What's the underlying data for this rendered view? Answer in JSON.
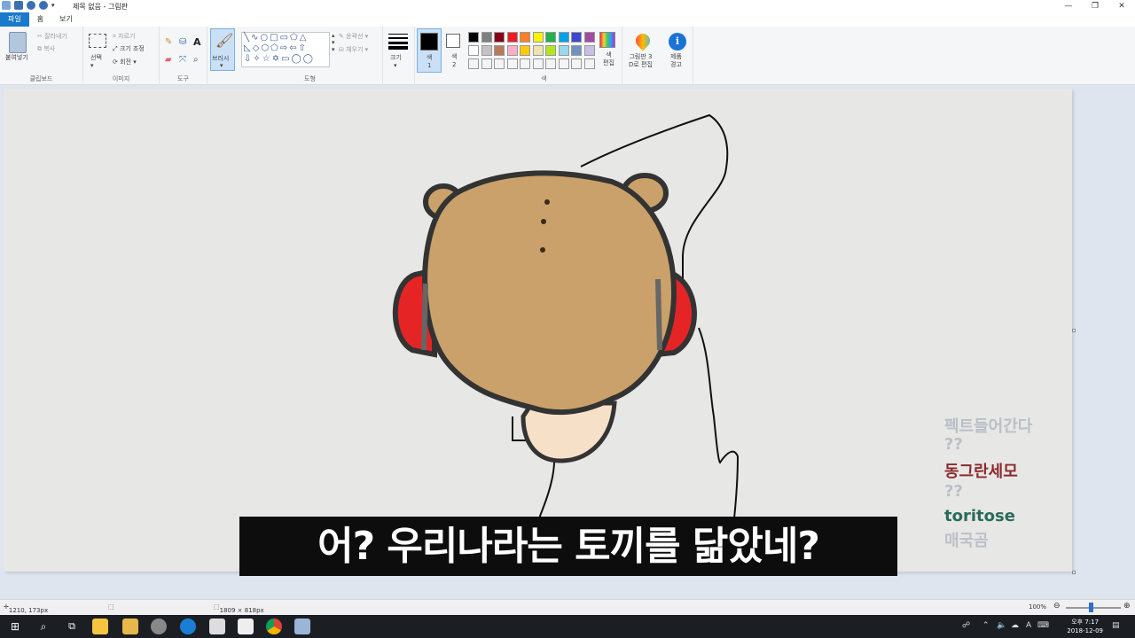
{
  "window": {
    "title": "제목 없음 - 그림판",
    "controls": [
      "—",
      "❐",
      "✕"
    ]
  },
  "tabs": [
    "파일",
    "홈",
    "보기"
  ],
  "ribbon": {
    "clipboard": {
      "paste": "붙여넣기",
      "cut": "잘라내기",
      "copy": "복사",
      "label": "클립보드"
    },
    "image": {
      "select": "선택",
      "crop": "자르기",
      "resize": "크기 조정",
      "rotate": "회전",
      "label": "이미지"
    },
    "tools": {
      "label": "도구"
    },
    "brush": {
      "label": "브러시"
    },
    "shapes": {
      "outline": "윤곽선",
      "fill": "채우기",
      "label": "도형"
    },
    "size": {
      "label": "크기"
    },
    "color1": {
      "label": "색\n1"
    },
    "color2": {
      "label": "색\n2"
    },
    "colors": {
      "label": "색",
      "row1": [
        "#000000",
        "#7f7f7f",
        "#880015",
        "#ed1c24",
        "#ff7f27",
        "#fff200",
        "#22b14c",
        "#00a2e8",
        "#3f48cc",
        "#a349a4"
      ],
      "row2": [
        "#ffffff",
        "#c3c3c3",
        "#b97a57",
        "#ffaec9",
        "#ffc90e",
        "#efe4b0",
        "#b5e61d",
        "#99d9ea",
        "#7092be",
        "#c8bfe7"
      ],
      "row3": [
        "#f4f4f4",
        "#f4f4f4",
        "#f4f4f4",
        "#f4f4f4",
        "#f4f4f4",
        "#f4f4f4",
        "#f4f4f4",
        "#f4f4f4",
        "#f4f4f4",
        "#f4f4f4"
      ],
      "edit": "색\n편집"
    },
    "paint3d": "그림판 3\nD로 편집",
    "product_alert": "제품\n경고"
  },
  "canvas": {
    "chat": [
      "펙트들어간다",
      "??",
      "동그란세모",
      "??",
      "toritose",
      "매국곰"
    ],
    "subtitle": "어? 우리나라는 토끼를 닮았네?"
  },
  "status": {
    "cursor_pos": "1210, 173px",
    "canvas_size": "1809 × 818px",
    "zoom": "100%"
  },
  "taskbar": {
    "time": "오후 7:17",
    "date": "2018-12-09",
    "ime": "A"
  }
}
